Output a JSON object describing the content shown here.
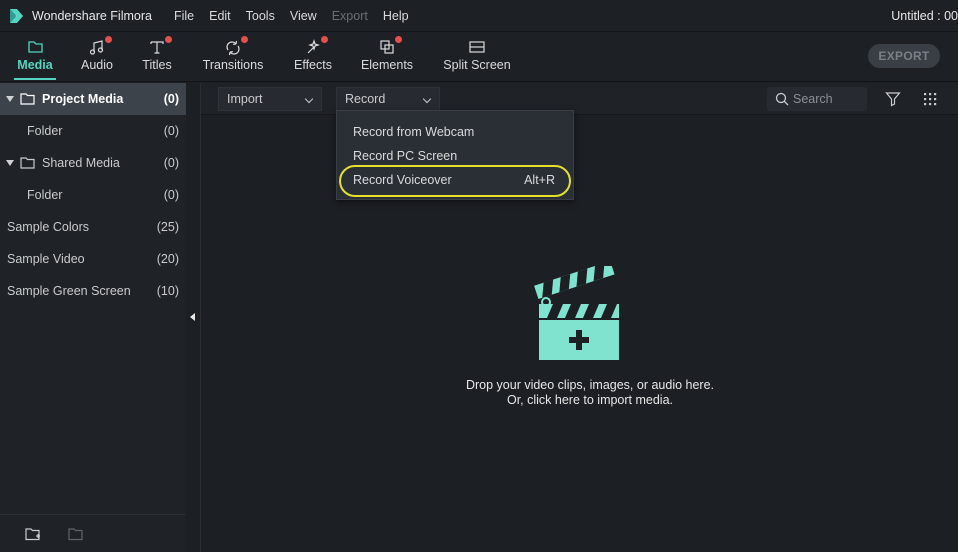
{
  "app": {
    "name": "Wondershare Filmora",
    "document_title": "Untitled : 00"
  },
  "menu": [
    {
      "label": "File",
      "enabled": true
    },
    {
      "label": "Edit",
      "enabled": true
    },
    {
      "label": "Tools",
      "enabled": true
    },
    {
      "label": "View",
      "enabled": true
    },
    {
      "label": "Export",
      "enabled": false
    },
    {
      "label": "Help",
      "enabled": true
    }
  ],
  "toolbar": {
    "tabs": [
      {
        "label": "Media",
        "icon": "folder-icon",
        "active": true,
        "badge": false
      },
      {
        "label": "Audio",
        "icon": "music-note-icon",
        "active": false,
        "badge": true
      },
      {
        "label": "Titles",
        "icon": "text-t-icon",
        "active": false,
        "badge": true
      },
      {
        "label": "Transitions",
        "icon": "transition-arrows-icon",
        "active": false,
        "badge": true
      },
      {
        "label": "Effects",
        "icon": "sparkle-icon",
        "active": false,
        "badge": true
      },
      {
        "label": "Elements",
        "icon": "layers-icon",
        "active": false,
        "badge": true
      },
      {
        "label": "Split Screen",
        "icon": "split-screen-icon",
        "active": false,
        "badge": false
      }
    ],
    "export_label": "EXPORT"
  },
  "sidebar": {
    "items": [
      {
        "label": "Project Media",
        "count": "(0)",
        "expandable": true,
        "folder_icon": true,
        "selected": true
      },
      {
        "label": "Folder",
        "count": "(0)",
        "expandable": false,
        "folder_icon": false,
        "selected": false
      },
      {
        "label": "Shared Media",
        "count": "(0)",
        "expandable": true,
        "folder_icon": true,
        "selected": false
      },
      {
        "label": "Folder",
        "count": "(0)",
        "expandable": false,
        "folder_icon": false,
        "selected": false
      },
      {
        "label": "Sample Colors",
        "count": "(25)",
        "expandable": false,
        "folder_icon": false,
        "selected": false
      },
      {
        "label": "Sample Video",
        "count": "(20)",
        "expandable": false,
        "folder_icon": false,
        "selected": false
      },
      {
        "label": "Sample Green Screen",
        "count": "(10)",
        "expandable": false,
        "folder_icon": false,
        "selected": false
      }
    ]
  },
  "media_bar": {
    "import_label": "Import",
    "record_label": "Record",
    "search_placeholder": "Search"
  },
  "record_menu": {
    "items": [
      {
        "label": "Record from Webcam",
        "shortcut": ""
      },
      {
        "label": "Record PC Screen",
        "shortcut": ""
      },
      {
        "label": "Record Voiceover",
        "shortcut": "Alt+R",
        "highlighted": true
      }
    ]
  },
  "empty_state": {
    "line1": "Drop your video clips, images, or audio here.",
    "line2": "Or, click here to import media."
  },
  "colors": {
    "accent": "#53d5c2",
    "badge": "#e2514b",
    "highlight_ring": "#e5e02a",
    "clapper": "#7fe3cf"
  }
}
